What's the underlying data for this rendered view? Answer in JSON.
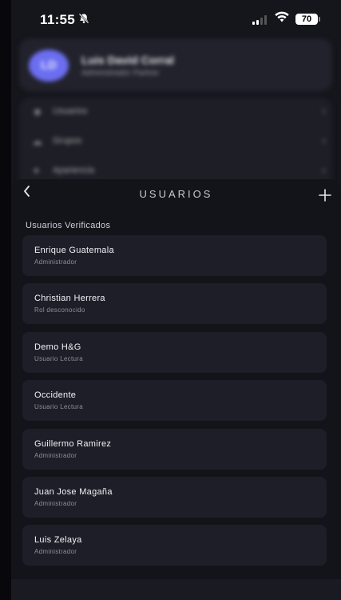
{
  "status_bar": {
    "time": "11:55",
    "battery": "70",
    "icons": [
      "bell-slash-icon",
      "signal-icon",
      "wifi-icon",
      "battery-icon"
    ]
  },
  "background": {
    "profile": {
      "initials": "LD",
      "name": "Luis David Corral",
      "role": "Administrador Partner"
    },
    "menu": [
      {
        "icon": "users-icon",
        "label": "Usuarios"
      },
      {
        "icon": "groups-icon",
        "label": "Grupos"
      },
      {
        "icon": "appearance-icon",
        "label": "Apariencia"
      }
    ]
  },
  "sheet": {
    "title": "USUARIOS",
    "section_label": "Usuarios Verificados",
    "users": [
      {
        "name": "Enrique Guatemala",
        "role": "Administrador"
      },
      {
        "name": "Christian Herrera",
        "role": "Rol desconocido"
      },
      {
        "name": "Demo H&G",
        "role": "Usuario Lectura"
      },
      {
        "name": "Occidente",
        "role": "Usuario Lectura"
      },
      {
        "name": "Guillermo Ramirez",
        "role": "Administrador"
      },
      {
        "name": "Juan Jose Magaña",
        "role": "Administrador"
      },
      {
        "name": "Luis Zelaya",
        "role": "Administrador"
      }
    ]
  },
  "colors": {
    "accent": "#6b6ef0",
    "card": "#1e1e28",
    "sheet": "#13131a"
  }
}
